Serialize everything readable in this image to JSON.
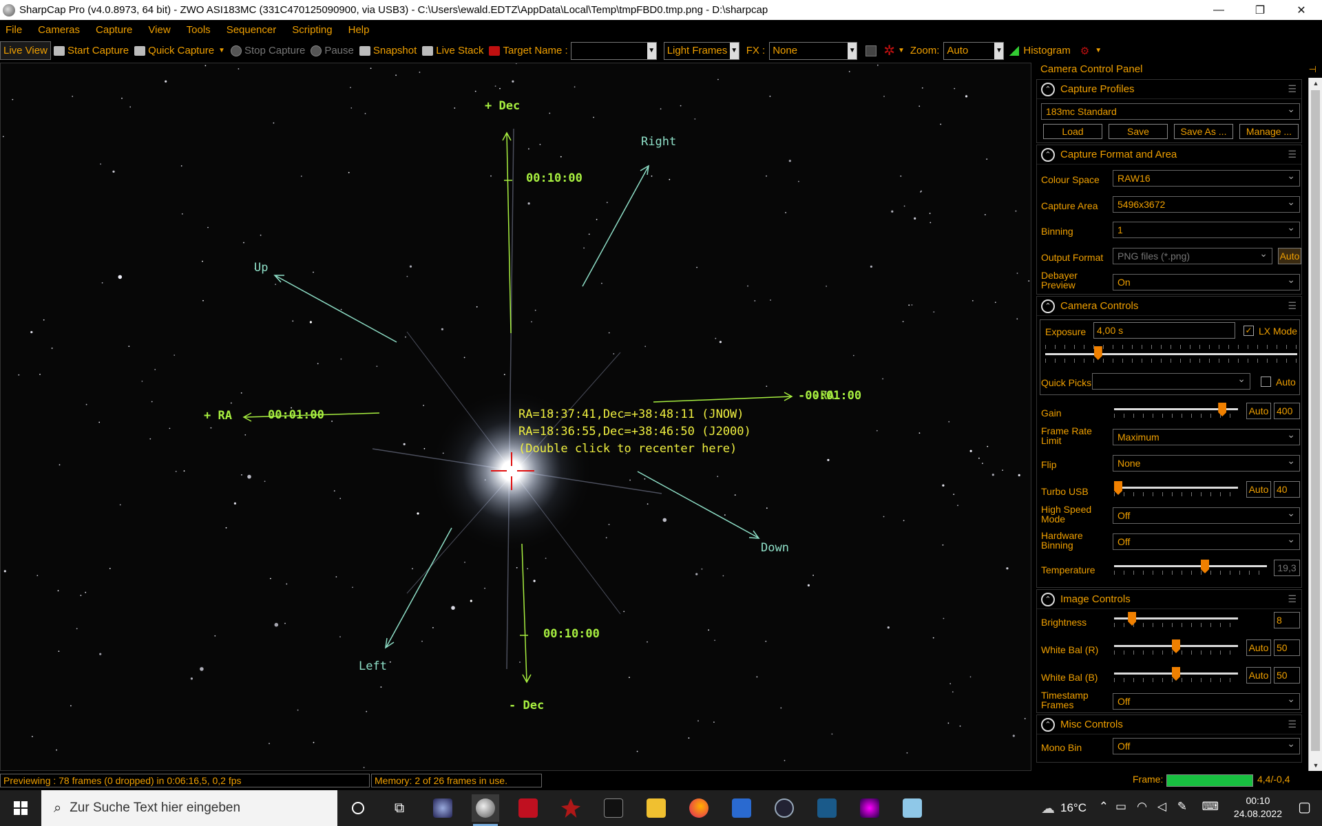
{
  "window": {
    "title": "SharpCap Pro (v4.0.8973, 64 bit) - ZWO ASI183MC (331C470125090900, via USB3) - C:\\Users\\ewald.EDTZ\\AppData\\Local\\Temp\\tmpFBD0.tmp.png - D:\\sharpcap",
    "minimize": "—",
    "restore": "❐",
    "close": "✕"
  },
  "menu": [
    "File",
    "Cameras",
    "Capture",
    "View",
    "Tools",
    "Sequencer",
    "Scripting",
    "Help"
  ],
  "toolbar": {
    "live_view": "Live View",
    "start_capture": "Start Capture",
    "quick_capture": "Quick Capture",
    "stop_capture": "Stop Capture",
    "pause": "Pause",
    "snapshot": "Snapshot",
    "live_stack": "Live Stack",
    "target_name_label": "Target Name :",
    "target_name_value": "",
    "frame_type": "Light Frames",
    "fx_label": "FX :",
    "fx_value": "None",
    "zoom_label": "Zoom:",
    "zoom_value": "Auto",
    "histogram": "Histogram"
  },
  "overlay": {
    "plus_dec": "+ Dec",
    "minus_dec": "- Dec",
    "plus_ra": "+ RA",
    "minus_ra": "-00:01:00",
    "minus_ra_overlap": "-RA",
    "dec_top_time": "00:10:00",
    "dec_bottom_time": "00:10:00",
    "ra_left_time": "00:01:00",
    "right": "Right",
    "left": "Left",
    "up": "Up",
    "down": "Down",
    "coord_jnow": "RA=18:37:41,Dec=+38:48:11 (JNOW)",
    "coord_j2000": "RA=18:36:55,Dec=+38:46:50 (J2000)",
    "recenter_hint": "(Double click to recenter here)"
  },
  "panel": {
    "title": "Camera Control Panel",
    "capture_profiles": {
      "header": "Capture Profiles",
      "profile": "183mc Standard",
      "load": "Load",
      "save": "Save",
      "save_as": "Save As ...",
      "manage": "Manage ..."
    },
    "format_area": {
      "header": "Capture Format and Area",
      "colour_space_label": "Colour Space",
      "colour_space": "RAW16",
      "capture_area_label": "Capture Area",
      "capture_area": "5496x3672",
      "binning_label": "Binning",
      "binning": "1",
      "output_format_label": "Output Format",
      "output_format": "PNG files (*.png)",
      "output_auto": "Auto",
      "debayer_label_1": "Debayer",
      "debayer_label_2": "Preview",
      "debayer": "On"
    },
    "camera_controls": {
      "header": "Camera Controls",
      "exposure_label": "Exposure",
      "exposure": "4,00 s",
      "lx_mode": "LX Mode",
      "exposure_slider": 0.2,
      "quick_picks_label": "Quick Picks",
      "quick_picks": "",
      "quick_auto": "Auto",
      "gain_label": "Gain",
      "gain_auto": "Auto",
      "gain": "400",
      "gain_slider": 0.9,
      "frame_rate_label_1": "Frame Rate",
      "frame_rate_label_2": "Limit",
      "frame_rate": "Maximum",
      "flip_label": "Flip",
      "flip": "None",
      "turbo_label": "Turbo USB",
      "turbo_auto": "Auto",
      "turbo": "40",
      "turbo_slider": 0.0,
      "hs_label_1": "High Speed",
      "hs_label_2": "Mode",
      "hs": "Off",
      "hwbin_label_1": "Hardware",
      "hwbin_label_2": "Binning",
      "hwbin": "Off",
      "temperature_label": "Temperature",
      "temperature": "19,3",
      "temperature_slider": 0.6
    },
    "image_controls": {
      "header": "Image Controls",
      "brightness_label": "Brightness",
      "brightness": "8",
      "brightness_slider": 0.12,
      "wb_r_label": "White Bal (R)",
      "wb_r_auto": "Auto",
      "wb_r": "50",
      "wb_r_slider": 0.5,
      "wb_b_label": "White Bal (B)",
      "wb_b_auto": "Auto",
      "wb_b": "50",
      "wb_b_slider": 0.5,
      "timestamp_label_1": "Timestamp",
      "timestamp_label_2": "Frames",
      "timestamp": "Off"
    },
    "misc_controls": {
      "header": "Misc Controls",
      "mono_bin_label": "Mono Bin",
      "mono_bin": "Off"
    }
  },
  "status": {
    "preview": "Previewing : 78 frames (0 dropped) in 0:06:16,5, 0,2 fps",
    "memory": "Memory: 2 of 26 frames in use.",
    "frame_label": "Frame:",
    "frame_progress": 1.0,
    "frame_value": "4,4/-0,4"
  },
  "taskbar": {
    "search_placeholder": "Zur Suche Text hier eingeben",
    "weather": "16°C",
    "time": "00:10",
    "date": "24.08.2022"
  }
}
